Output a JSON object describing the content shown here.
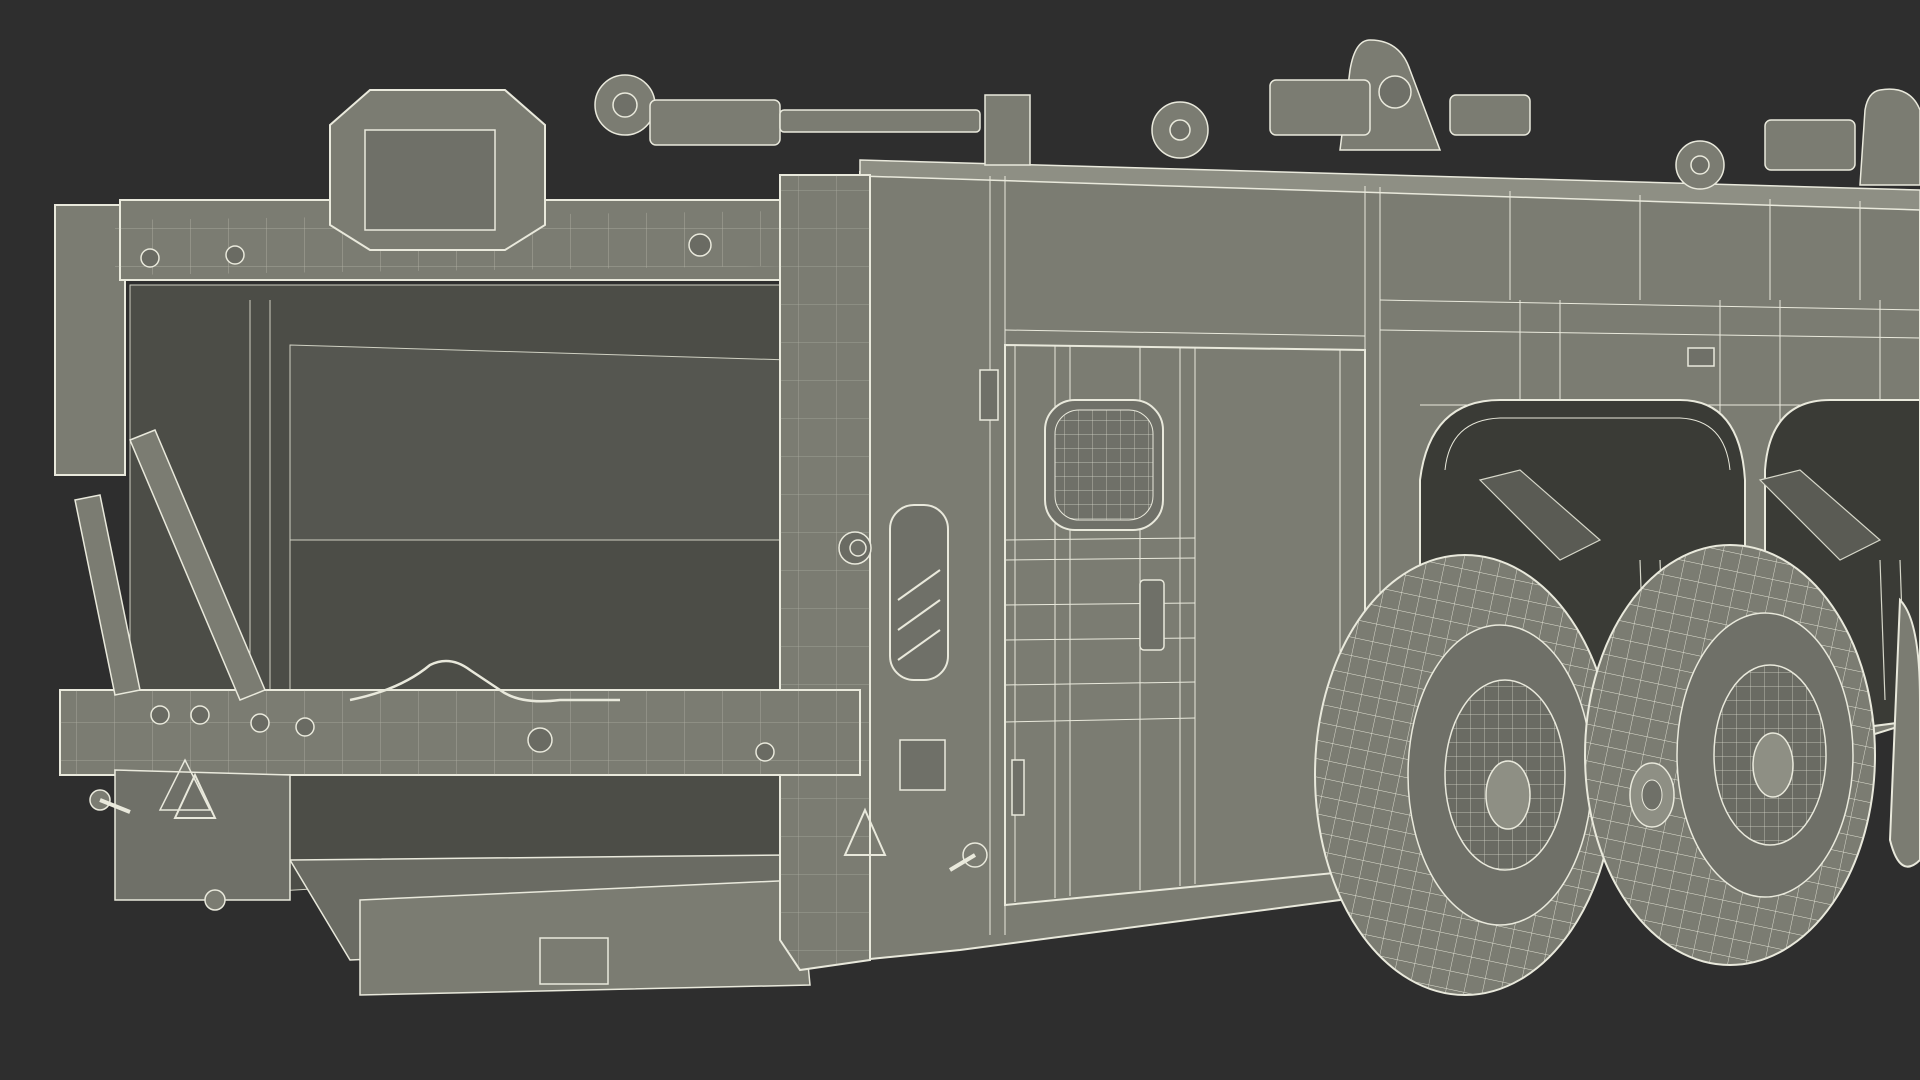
{
  "scene": {
    "background_color": "#2e2e2e",
    "body_color": "#7b7c72",
    "body_color_dark": "#5f6058",
    "body_color_light": "#8e8f84",
    "wire_color": "#e9e9dc",
    "wire_color_dim": "#cfd0c2",
    "interior_color": "#4c4d47",
    "shadow_color": "#3a3b36"
  }
}
